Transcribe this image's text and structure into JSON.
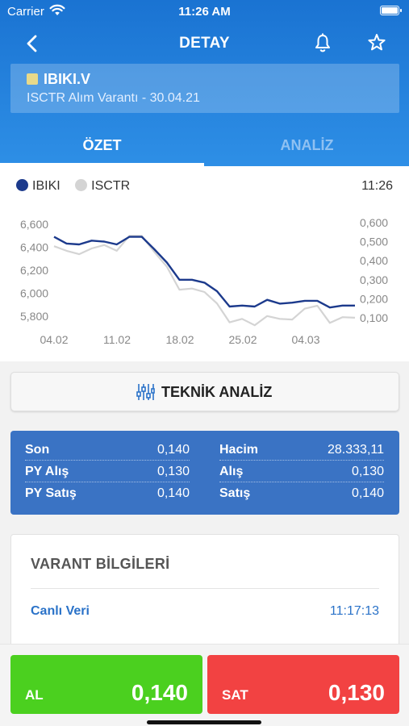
{
  "status_bar": {
    "carrier": "Carrier",
    "time": "11:26 AM"
  },
  "nav": {
    "title": "DETAY",
    "back_icon": "chevron-left-icon",
    "bell_icon": "bell-icon",
    "star_icon": "star-icon"
  },
  "instrument": {
    "symbol": "IBIKI.V",
    "description": "ISCTR Alım Varantı - 30.04.21",
    "color": "#e8d98a"
  },
  "tabs": [
    {
      "label": "ÖZET",
      "active": true
    },
    {
      "label": "ANALİZ",
      "active": false
    }
  ],
  "chart_panel": {
    "time": "11:26",
    "legend": [
      {
        "name": "IBIKI",
        "color": "#1c3a8c"
      },
      {
        "name": "ISCTR",
        "color": "#d4d4d4"
      }
    ]
  },
  "chart_data": {
    "type": "line",
    "x_ticks": [
      "04.02",
      "11.02",
      "18.02",
      "25.02",
      "04.03"
    ],
    "left_axis": {
      "ticks": [
        "6,600",
        "6,400",
        "6,200",
        "6,000",
        "5,800"
      ],
      "range": [
        5700,
        6700
      ]
    },
    "right_axis": {
      "ticks": [
        "0,600",
        "0,500",
        "0,400",
        "0,300",
        "0,200",
        "0,100"
      ],
      "range": [
        0.05,
        0.65
      ]
    },
    "series": [
      {
        "name": "IBIKI",
        "axis": "right",
        "color": "#1c3a8c",
        "values": [
          0.525,
          0.49,
          0.485,
          0.505,
          0.5,
          0.485,
          0.525,
          0.525,
          0.46,
          0.39,
          0.3,
          0.3,
          0.285,
          0.24,
          0.16,
          0.165,
          0.16,
          0.195,
          0.175,
          0.18,
          0.19,
          0.19,
          0.155,
          0.165,
          0.165
        ]
      },
      {
        "name": "ISCTR",
        "axis": "left",
        "color": "#d4d4d4",
        "values": [
          6410,
          6370,
          6340,
          6390,
          6420,
          6370,
          6500,
          6500,
          6360,
          6230,
          6030,
          6040,
          6010,
          5910,
          5745,
          5775,
          5720,
          5800,
          5775,
          5770,
          5865,
          5890,
          5740,
          5790,
          5785
        ]
      }
    ]
  },
  "technical_button": {
    "label": "TEKNİK ANALİZ",
    "icon": "sliders-icon"
  },
  "stats": [
    {
      "key": "Son",
      "value": "0,140"
    },
    {
      "key": "Hacim",
      "value": "28.333,11"
    },
    {
      "key": "PY Alış",
      "value": "0,130"
    },
    {
      "key": "Alış",
      "value": "0,130"
    },
    {
      "key": "PY Satış",
      "value": "0,140"
    },
    {
      "key": "Satış",
      "value": "0,140"
    }
  ],
  "varant_info": {
    "title": "VARANT BİLGİLERİ",
    "row_label": "Canlı Veri",
    "row_value": "11:17:13"
  },
  "trade": {
    "buy": {
      "label": "AL",
      "price": "0,140",
      "color": "#4bd01f"
    },
    "sell": {
      "label": "SAT",
      "price": "0,130",
      "color": "#f24242"
    }
  }
}
